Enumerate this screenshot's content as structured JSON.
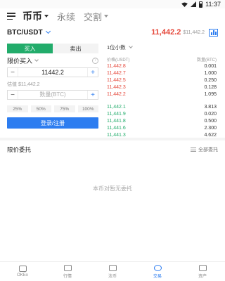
{
  "status_bar": {
    "time": "11:37"
  },
  "top_nav": {
    "tabs": [
      {
        "label": "币币",
        "active": true
      },
      {
        "label": "永续",
        "active": false
      },
      {
        "label": "交割",
        "active": false
      }
    ]
  },
  "pair": {
    "name": "BTC/USDT",
    "last_price": "11,442.2",
    "fiat_price": "$11,442.2"
  },
  "trade": {
    "buy_label": "买入",
    "sell_label": "卖出",
    "order_type": "限价买入",
    "help": "?",
    "price_value": "11442.2",
    "valuation_label": "估值 $11,442.2",
    "amount_placeholder": "数量(BTC)",
    "minus": "−",
    "plus": "+",
    "percents": [
      "25%",
      "50%",
      "75%",
      "100%"
    ],
    "login_label": "登录/注册"
  },
  "order_book": {
    "precision": "1位小数",
    "price_header": "价格(USDT)",
    "qty_header": "数量(BTC)",
    "asks": [
      {
        "price": "11,442.8",
        "qty": "0.001"
      },
      {
        "price": "11,442.7",
        "qty": "1.000"
      },
      {
        "price": "11,442.5",
        "qty": "0.250"
      },
      {
        "price": "11,442.3",
        "qty": "0.128"
      },
      {
        "price": "11,442.2",
        "qty": "1.095"
      }
    ],
    "bids": [
      {
        "price": "11,442.1",
        "qty": "3.813"
      },
      {
        "price": "11,441.9",
        "qty": "0.020"
      },
      {
        "price": "11,441.8",
        "qty": "0.500"
      },
      {
        "price": "11,441.6",
        "qty": "2.300"
      },
      {
        "price": "11,441.3",
        "qty": "4.622"
      }
    ]
  },
  "orders": {
    "title": "限价委托",
    "all_label": "全部委托",
    "empty": "本币对暂无委托"
  },
  "bottom_nav": [
    {
      "label": "OKEx",
      "icon": "home-icon",
      "active": false
    },
    {
      "label": "行情",
      "icon": "market-icon",
      "active": false
    },
    {
      "label": "法币",
      "icon": "fiat-icon",
      "active": false
    },
    {
      "label": "交易",
      "icon": "trade-icon",
      "active": true
    },
    {
      "label": "资产",
      "icon": "wallet-icon",
      "active": false
    }
  ],
  "colors": {
    "accent": "#2d7df0",
    "buy": "#22ac6b",
    "sell": "#e5473a"
  }
}
